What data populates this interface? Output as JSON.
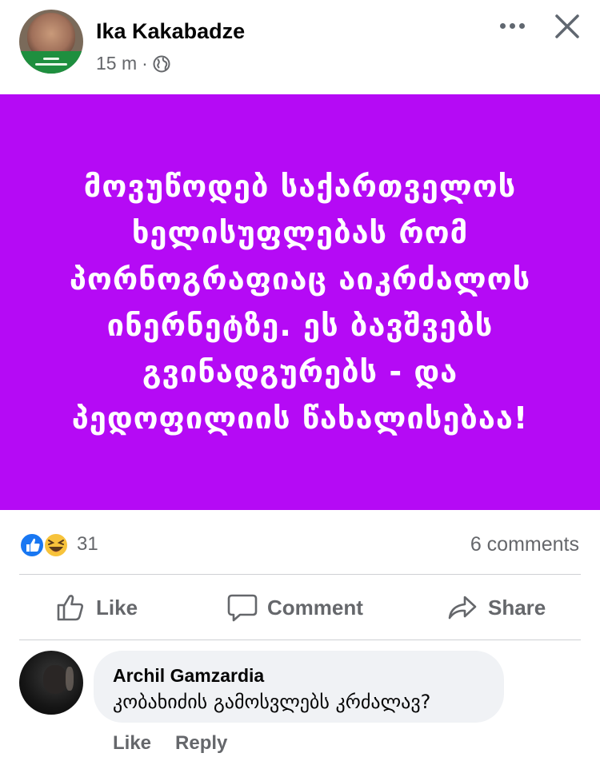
{
  "post": {
    "author_name": "Ika Kakabadze",
    "timestamp": "15 m",
    "separator": "·",
    "privacy_icon": "globe-icon",
    "background_color": "#b50af5",
    "text_lines": [
      "მოვუწოდებ საქართველოს",
      "ხელისუფლებას რომ",
      "პორნოგრაფიაც აიკრძალოს",
      "ინერნეტზე.  ეს ბავშვებს",
      "გვინადგურებს - და",
      "პედოფილიის წახალისებაა!"
    ]
  },
  "stats": {
    "reaction_icons": [
      "like-icon",
      "haha-icon"
    ],
    "reaction_count": "31",
    "comments_count": "6 comments"
  },
  "actions": {
    "like": "Like",
    "comment": "Comment",
    "share": "Share"
  },
  "comment": {
    "author": "Archil Gamzardia",
    "text": "კობახიძის გამოსვლებს კრძალავ?",
    "like": "Like",
    "reply": "Reply"
  },
  "colors": {
    "accent_blue": "#1877f2",
    "secondary_text": "#65676b",
    "bubble": "#f0f2f5"
  }
}
